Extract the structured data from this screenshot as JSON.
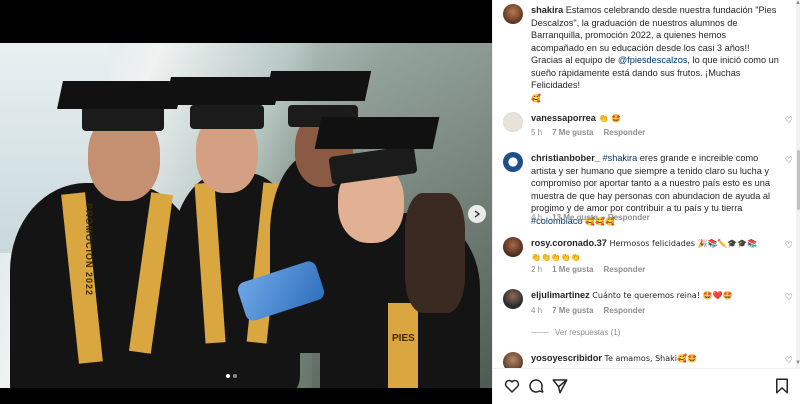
{
  "post": {
    "author": "shakira",
    "caption_main": "Estamos celebrando desde nuestra fundación \"Pies Descalzos\", la graduación de nuestros alumnos de Barranquilla, promoción 2022, a quienes hemos acompañado en su educación desde los casi 3 años!!",
    "caption_thanks_pre": "Gracias al equipo de ",
    "caption_mention": "@fpiesdescalzos",
    "caption_thanks_post": ", lo que inició como un sueño rápidamente está dando sus frutos. ¡Muchas Felicidades!",
    "caption_emoji": "🥰"
  },
  "photo": {
    "stole_text": "PROMOCIÓN 2022",
    "stole_text2": "PIES"
  },
  "comments": [
    {
      "user": "vanessaporrea",
      "text": "👏 🤩",
      "time": "5 h",
      "likes": "7 Me gusta",
      "reply": "Responder"
    },
    {
      "user": "christianbober_",
      "mention": "#shakira",
      "text": " eres grande e increible como artista y ser humano que siempre a tenido claro su lucha y compromiso por aportar tanto a a nuestro país esto es una muestra de que hay personas con abundacion de ayuda al progimo y de amor por contribuir a tu país y tu tierra ",
      "hashtag": "#colombiaco",
      "emojis": " 🥰🥰🥰",
      "time": "4 h",
      "likes": "13 Me gusta",
      "reply": "Responder"
    },
    {
      "user": "rosy.coronado.37",
      "text": "Hermosos felicidades 🎉📚✏️🎓🎓📚",
      "emojis2": "👏👏👏👏👏",
      "time": "2 h",
      "likes": "1 Me gusta",
      "reply": "Responder"
    },
    {
      "user": "eljulimartinez",
      "text": "Cuánto te queremos reina! 🤩❤️🤩",
      "time": "4 h",
      "likes": "7 Me gusta",
      "reply": "Responder"
    },
    {
      "user": "yosoyescribidor",
      "text": "Te amamos, Shaki🥰🤩"
    }
  ],
  "view_replies": "Ver respuestas (1)",
  "icons": {
    "like": "heart-icon",
    "comment": "comment-icon",
    "share": "share-icon",
    "save": "bookmark-icon"
  }
}
